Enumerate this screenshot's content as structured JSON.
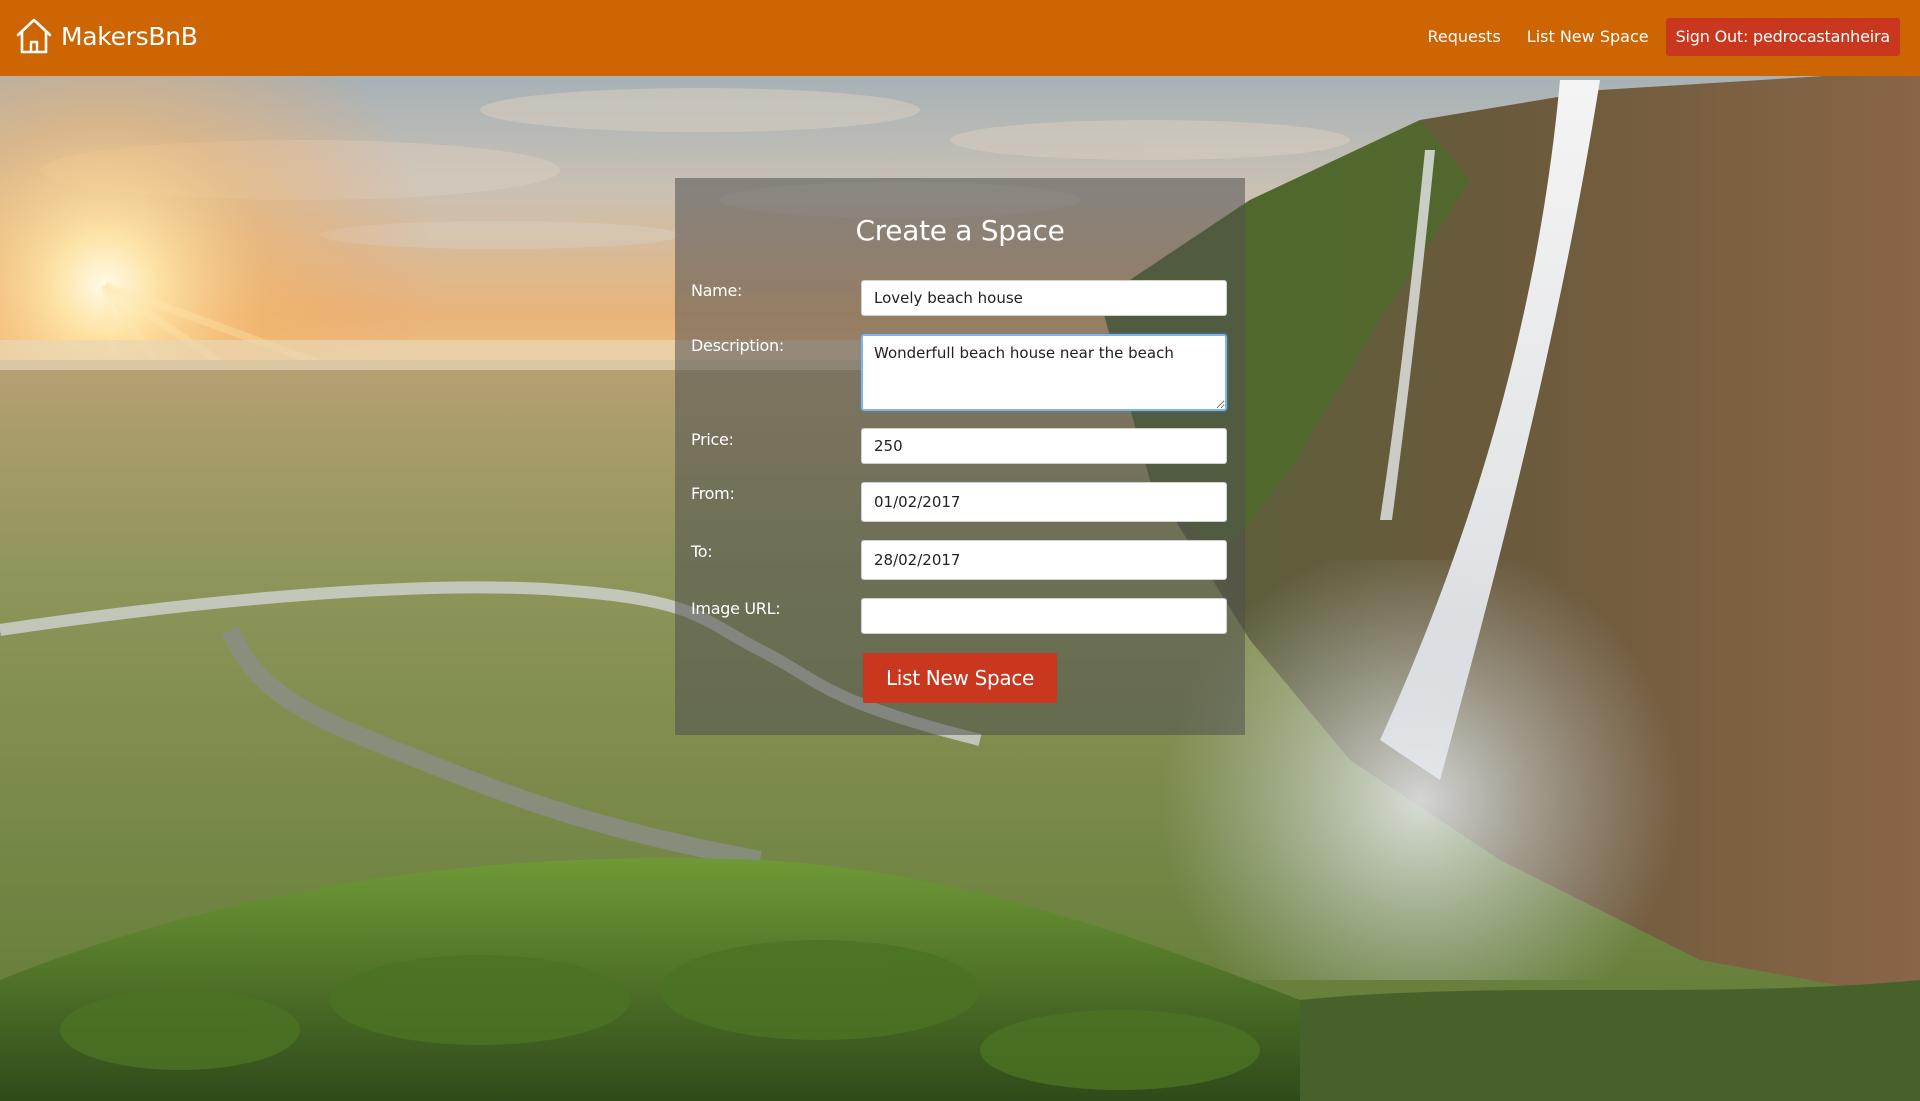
{
  "header": {
    "brand_name": "MakersBnB",
    "brand_icon": "house-icon",
    "nav": {
      "requests_label": "Requests",
      "list_new_space_label": "List New Space",
      "sign_out_label": "Sign Out: pedrocastanheira"
    }
  },
  "form": {
    "title": "Create a Space",
    "name": {
      "label": "Name:",
      "value": "Lovely beach house"
    },
    "description": {
      "label": "Description:",
      "value": "Wonderfull beach house near the beach"
    },
    "price": {
      "label": "Price:",
      "value": "250"
    },
    "from": {
      "label": "From:",
      "value": "01/02/2017"
    },
    "to": {
      "label": "To:",
      "value": "28/02/2017"
    },
    "image_url": {
      "label": "Image URL:",
      "value": ""
    },
    "submit_label": "List New Space"
  },
  "colors": {
    "header_bg": "#cd6502",
    "accent_red": "#c8371e",
    "panel_bg": "rgba(80,80,80,0.55)",
    "text_light": "#ffffff"
  }
}
